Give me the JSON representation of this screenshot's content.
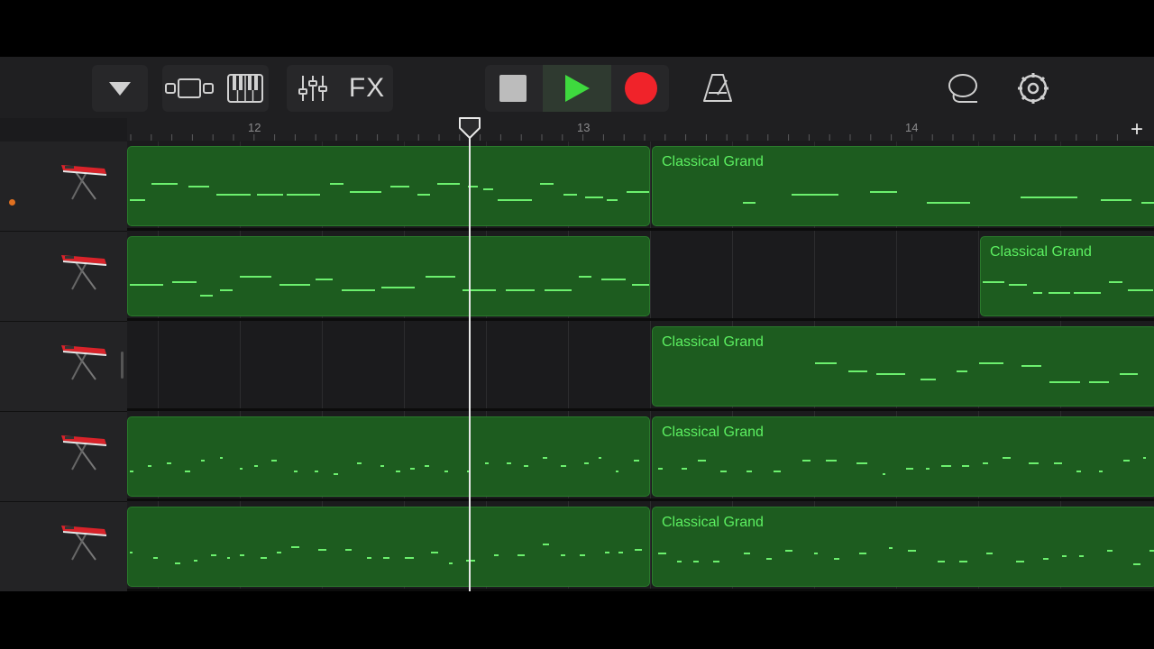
{
  "toolbar": {
    "buttons": [
      {
        "name": "browser-toggle-button",
        "icon": "triangle-down-icon"
      },
      {
        "name": "tracks-view-button",
        "icon": "tracks-view-icon"
      },
      {
        "name": "smart-controls-button",
        "icon": "piano-keys-icon"
      },
      {
        "name": "mixer-button",
        "icon": "sliders-icon"
      },
      {
        "name": "fx-button",
        "label": "FX"
      },
      {
        "name": "stop-button",
        "icon": "stop-icon"
      },
      {
        "name": "play-button",
        "icon": "play-icon"
      },
      {
        "name": "record-button",
        "icon": "record-icon"
      },
      {
        "name": "metronome-button",
        "icon": "metronome-icon"
      },
      {
        "name": "loop-browser-button",
        "icon": "lasso-icon"
      },
      {
        "name": "settings-button",
        "icon": "gear-icon"
      }
    ],
    "fx_label": "FX",
    "colors": {
      "play": "#3ed93e",
      "record": "#f0232a",
      "stop": "#bcbcbc",
      "icon": "#d0d0d0"
    }
  },
  "ruler": {
    "bars": [
      "12",
      "13",
      "14"
    ],
    "add_label": "+"
  },
  "tracks": [
    {
      "instrument": "keyboard-icon",
      "record_enabled": true
    },
    {
      "instrument": "keyboard-icon",
      "record_enabled": false
    },
    {
      "instrument": "keyboard-icon",
      "record_enabled": false
    },
    {
      "instrument": "keyboard-icon",
      "record_enabled": false
    },
    {
      "instrument": "keyboard-icon",
      "record_enabled": false
    }
  ],
  "regions": [
    {
      "track": 0,
      "name": ""
    },
    {
      "track": 0,
      "name": "Classical Grand"
    },
    {
      "track": 1,
      "name": ""
    },
    {
      "track": 1,
      "name": "Classical Grand"
    },
    {
      "track": 2,
      "name": "Classical Grand"
    },
    {
      "track": 3,
      "name": ""
    },
    {
      "track": 3,
      "name": "Classical Grand"
    },
    {
      "track": 4,
      "name": ""
    },
    {
      "track": 4,
      "name": "Classical Grand"
    }
  ],
  "colors": {
    "region_fill": "#1d5c1f",
    "note": "#6cf06e",
    "region_label": "#5cf061"
  }
}
